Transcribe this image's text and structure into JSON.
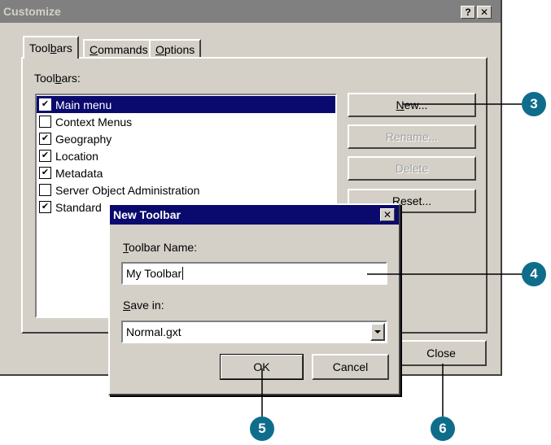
{
  "customize_dialog": {
    "title": "Customize",
    "help_btn": "?",
    "close_btn": "✕",
    "tabs": [
      {
        "label_pre": "Tool",
        "label_u": "b",
        "label_post": "ars"
      },
      {
        "label_pre": "",
        "label_u": "C",
        "label_post": "ommands"
      },
      {
        "label_pre": "",
        "label_u": "O",
        "label_post": "ptions"
      }
    ],
    "list_label_pre": "Tool",
    "list_label_u": "b",
    "list_label_post": "ars:",
    "toolbars": [
      {
        "label": "Main menu",
        "checked": "✔"
      },
      {
        "label": "Context Menus",
        "checked": ""
      },
      {
        "label": "Geography",
        "checked": "✔"
      },
      {
        "label": "Location",
        "checked": "✔"
      },
      {
        "label": "Metadata",
        "checked": "✔"
      },
      {
        "label": "Server Object Administration",
        "checked": ""
      },
      {
        "label": "Standard",
        "checked": "✔"
      }
    ],
    "buttons": {
      "new_u": "N",
      "new_post": "ew...",
      "rename": "Rename...",
      "delete": "Delete",
      "reset_pre": "",
      "reset_u": "R",
      "reset_post": "eset...",
      "close": "Close"
    }
  },
  "new_toolbar_dialog": {
    "title": "New Toolbar",
    "close_btn": "✕",
    "name_label_u": "T",
    "name_label_post": "oolbar Name:",
    "name_value": "My Toolbar",
    "save_label_u": "S",
    "save_label_post": "ave in:",
    "save_value": "Normal.gxt",
    "ok": "OK",
    "cancel": "Cancel"
  },
  "callouts": [
    "3",
    "4",
    "5",
    "6"
  ],
  "colors": {
    "titlebar_active": "#0a0a6e",
    "titlebar_inactive": "#808080",
    "face": "#d4d0c8",
    "callout": "#0f6d8c"
  }
}
